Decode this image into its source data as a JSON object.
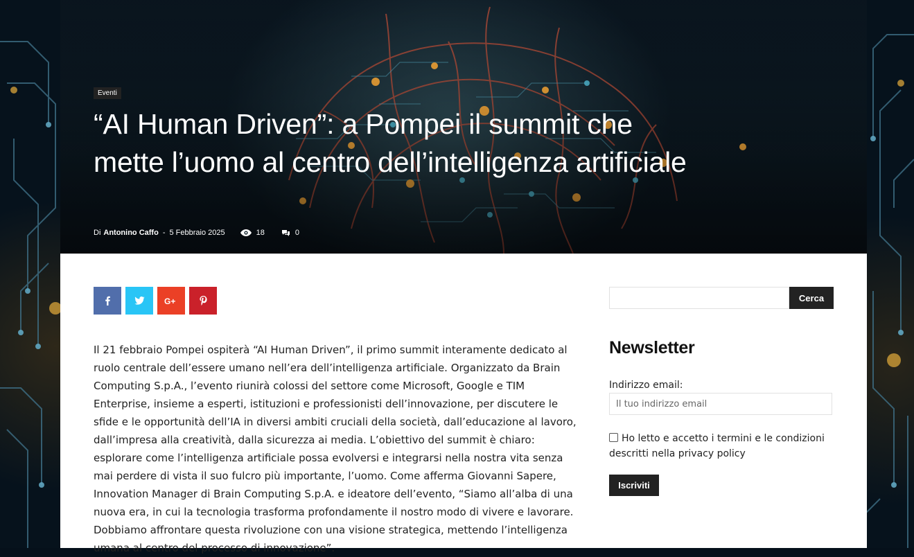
{
  "hero": {
    "category": "Eventi",
    "title": "“AI Human Driven”: a Pompei il summit che mette l’uomo al centro dell’intelligenza artificiale",
    "meta": {
      "by": "Di",
      "author": "Antonino Caffo",
      "separator": "-",
      "date": "5 Febbraio 2025",
      "views": "18",
      "comments": "0"
    }
  },
  "share": {
    "icons": [
      "facebook-icon",
      "twitter-icon",
      "google-plus-icon",
      "pinterest-icon"
    ],
    "colors": {
      "facebook": "#516eab",
      "twitter": "#29c5f6",
      "google_plus": "#eb4026",
      "pinterest": "#ca212a"
    }
  },
  "article": {
    "body": "Il 21 febbraio Pompei ospiterà “AI Human Driven”, il primo summit interamente dedicato al ruolo centrale dell’essere umano nell’era dell’intelligenza artificiale. Organizzato da Brain Computing S.p.A., l’evento riunirà colossi del settore come Microsoft, Google e TIM Enterprise, insieme a esperti, istituzioni e professionisti dell’innovazione, per discutere le sfide e le opportunità dell’IA in diversi ambiti cruciali della società, dall’educazione al lavoro, dall’impresa alla creatività, dalla sicurezza ai media. L’obiettivo del summit è chiaro: esplorare come l’intelligenza artificiale possa evolversi e integrarsi nella nostra vita senza mai perdere di vista il suo fulcro più importante, l’uomo. Come afferma Giovanni Sapere, Innovation Manager di Brain Computing S.p.A. e ideatore dell’evento, “Siamo all’alba di una nuova era, in cui la tecnologia trasforma profondamente il nostro modo di vivere e lavorare. Dobbiamo affrontare questa rivoluzione con una visione strategica, mettendo l’intelligenza umana al centro del processo di innovazione”."
  },
  "sidebar": {
    "search": {
      "value": "",
      "button": "Cerca"
    },
    "newsletter": {
      "title": "Newsletter",
      "email_label": "Indirizzo email:",
      "email_placeholder": "Il tuo indirizzo email",
      "privacy_text": "Ho letto e accetto i termini e le condizioni descritti nella privacy policy",
      "privacy_checked": false,
      "subscribe_button": "Iscriviti"
    }
  }
}
